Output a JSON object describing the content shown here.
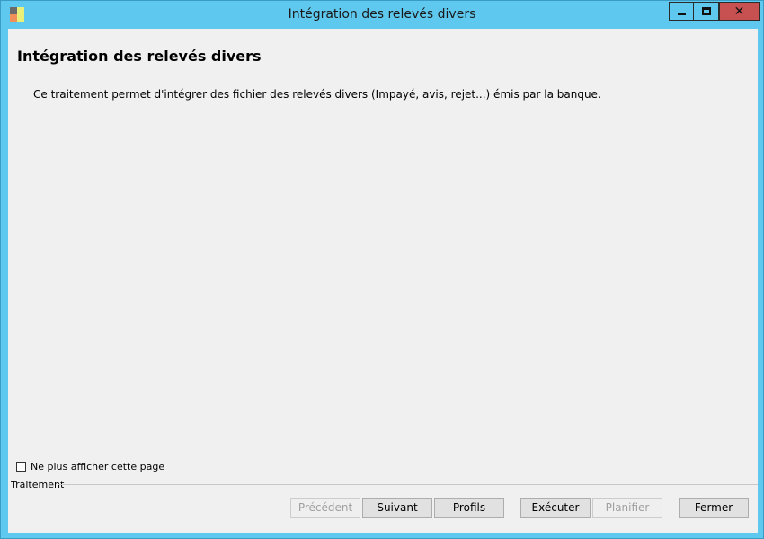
{
  "window": {
    "title": "Intégration des relevés divers",
    "controls": {
      "minimize": "minimize-icon",
      "maximize": "maximize-icon",
      "close": "close-icon"
    }
  },
  "main": {
    "heading": "Intégration des relevés divers",
    "description": "Ce traitement permet d'intégrer des fichier des relevés divers (Impayé, avis, rejet...) émis par la banque."
  },
  "options": {
    "hide_page_label": "Ne plus afficher cette page",
    "hide_page_checked": false
  },
  "footer": {
    "group_label": "Traitement",
    "buttons": {
      "precedent": "Précédent",
      "suivant": "Suivant",
      "profils": "Profils",
      "executer": "Exécuter",
      "planifier": "Planifier",
      "fermer": "Fermer"
    }
  },
  "colors": {
    "titlebar": "#5ec8ee",
    "close_button": "#c75050",
    "client_bg": "#f0f0f0"
  }
}
